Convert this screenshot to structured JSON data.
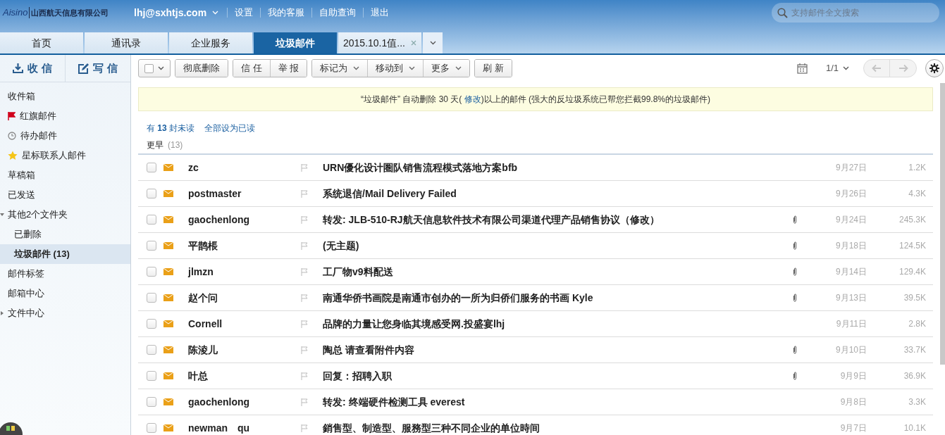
{
  "logo": {
    "brand": "Aisino",
    "company": "山西航天信息有限公司"
  },
  "account": {
    "email": "lhj@sxhtjs.com"
  },
  "top_links": [
    "设置",
    "我的客服",
    "自助查询",
    "退出"
  ],
  "search": {
    "placeholder": "支持邮件全文搜索"
  },
  "tabs": [
    {
      "label": "首页",
      "selected": false,
      "closable": false
    },
    {
      "label": "通讯录",
      "selected": false,
      "closable": false
    },
    {
      "label": "企业服务",
      "selected": false,
      "closable": false
    },
    {
      "label": "垃圾邮件",
      "selected": true,
      "closable": false
    },
    {
      "label": "2015.10.1值...",
      "selected": false,
      "closable": true
    }
  ],
  "sidebar": {
    "receive": "收 信",
    "compose": "写 信",
    "items": [
      {
        "label": "收件箱",
        "kind": "plain",
        "selected": false
      },
      {
        "label": "红旗邮件",
        "kind": "flag",
        "selected": false
      },
      {
        "label": "待办邮件",
        "kind": "clock",
        "selected": false
      },
      {
        "label": "星标联系人邮件",
        "kind": "star",
        "selected": false
      },
      {
        "label": "草稿箱",
        "kind": "plain",
        "selected": false
      },
      {
        "label": "已发送",
        "kind": "plain",
        "selected": false
      },
      {
        "label": "其他2个文件夹",
        "kind": "folder",
        "selected": false,
        "expanded": true,
        "children": [
          {
            "label": "已删除",
            "selected": false
          },
          {
            "label": "垃圾邮件 (13)",
            "selected": true
          }
        ]
      },
      {
        "label": "邮件标签",
        "kind": "plain",
        "selected": false
      },
      {
        "label": "邮箱中心",
        "kind": "plain",
        "selected": false
      },
      {
        "label": "文件中心",
        "kind": "folder",
        "selected": false,
        "expanded": false
      }
    ]
  },
  "toolbar": {
    "groups": [
      [
        {
          "label": "彻底删除",
          "dropdown": false
        }
      ],
      [
        {
          "label": "信 任",
          "dropdown": false
        },
        {
          "label": "举 报",
          "dropdown": false
        }
      ],
      [
        {
          "label": "标记为",
          "dropdown": true
        },
        {
          "label": "移动到",
          "dropdown": true
        },
        {
          "label": "更多",
          "dropdown": true
        }
      ],
      [
        {
          "label": "刷 新",
          "dropdown": false
        }
      ]
    ],
    "page": "1/1"
  },
  "notice": {
    "before": "“垃圾邮件” 自动删除 30 天(",
    "link": "修改",
    "after": ")以上的邮件 (强大的反垃圾系统已帮您拦截99.8%的垃圾邮件)"
  },
  "unread": {
    "text": "有 **13** 封未读",
    "mark_all": "全部设为已读"
  },
  "group": {
    "label": "更早",
    "count": "(13)"
  },
  "messages": [
    {
      "checked": false,
      "sender": "zc",
      "subject": "URN優化设计圏队销售流程模式落地方案bfb",
      "attachment": false,
      "date": "9月27日",
      "size": "1.2K"
    },
    {
      "checked": false,
      "sender": "postmaster",
      "subject": "系统退信/Mail Delivery Failed",
      "attachment": false,
      "date": "9月26日",
      "size": "4.3K"
    },
    {
      "checked": false,
      "sender": "gaochenlong",
      "subject": "转发: JLB-510-RJ航天信息软件技术有限公司渠道代理产品销售协议（修改）",
      "attachment": true,
      "date": "9月24日",
      "size": "245.3K"
    },
    {
      "checked": false,
      "sender": "平鹊棖",
      "subject": "(无主题)",
      "attachment": true,
      "date": "9月18日",
      "size": "124.5K"
    },
    {
      "checked": false,
      "sender": "jlmzn",
      "subject": "工厂物v9料配送",
      "attachment": true,
      "date": "9月14日",
      "size": "129.4K"
    },
    {
      "checked": false,
      "sender": "赵个问",
      "subject": "南通华侨书画院是南通市创办的一所为归侨们服务的书画 Kyle",
      "attachment": true,
      "date": "9月13日",
      "size": "39.5K"
    },
    {
      "checked": false,
      "sender": "Cornell",
      "subject": "品牌的力量让您身临其境感受网.投盛宴lhj",
      "attachment": false,
      "date": "9月11日",
      "size": "2.8K"
    },
    {
      "checked": false,
      "sender": "陈淩儿",
      "subject": "陶总 请查看附件内容",
      "attachment": true,
      "date": "9月10日",
      "size": "33.7K"
    },
    {
      "checked": false,
      "sender": "叶总",
      "subject": "回复：招聘入职",
      "attachment": true,
      "date": "9月9日",
      "size": "36.9K"
    },
    {
      "checked": false,
      "sender": "gaochenlong",
      "subject": "转发: 终端硬件检测工具 everest",
      "attachment": false,
      "date": "9月8日",
      "size": "3.3K"
    },
    {
      "checked": false,
      "sender": "newman　qu",
      "subject": "銷售型、制造型、服務型三种不同企业的单位時间",
      "attachment": false,
      "date": "9月7日",
      "size": "10.1K"
    }
  ]
}
